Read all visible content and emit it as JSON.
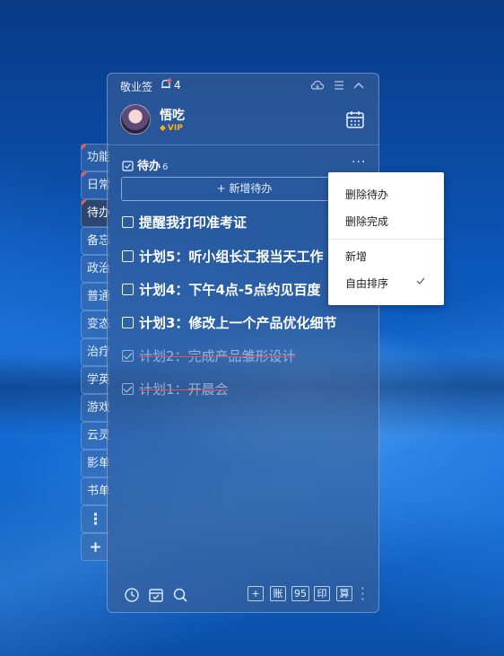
{
  "side_tabs": [
    {
      "label": "功能",
      "flag": true
    },
    {
      "label": "日常",
      "flag": true
    },
    {
      "label": "待办",
      "flag": true,
      "active": true
    },
    {
      "label": "备忘",
      "flag": false
    },
    {
      "label": "政治",
      "flag": false
    },
    {
      "label": "普通",
      "flag": false
    },
    {
      "label": "变态",
      "flag": false
    },
    {
      "label": "治疗",
      "flag": false
    },
    {
      "label": "学英",
      "flag": false
    },
    {
      "label": "游戏",
      "flag": false
    },
    {
      "label": "云灵",
      "flag": false
    },
    {
      "label": "影单",
      "flag": false
    },
    {
      "label": "书单",
      "flag": false
    },
    {
      "label": "⋮",
      "flag": false
    },
    {
      "label": "+",
      "flag": false
    }
  ],
  "titlebar": {
    "app_name": "敬业签",
    "notification_count": "4",
    "icons": [
      "cloud-sync-icon",
      "menu-icon",
      "collapse-icon"
    ]
  },
  "profile": {
    "username": "悟吃",
    "badge": "VIP"
  },
  "section": {
    "title": "待办",
    "count": "6",
    "more": "···"
  },
  "add_button": {
    "label": "+ 新增待办"
  },
  "todos": [
    {
      "text": "提醒我打印准考证",
      "done": false
    },
    {
      "text": "计划5：听小组长汇报当天工作",
      "done": false
    },
    {
      "text": "计划4：下午4点-5点约见百度",
      "done": false
    },
    {
      "text": "计划3：修改上一个产品优化细节",
      "done": false
    },
    {
      "text": "计划2：完成产品雏形设计",
      "done": true
    },
    {
      "text": "计划1：开晨会",
      "done": true
    }
  ],
  "bottom_bar": {
    "left_icons": [
      "clock-icon",
      "archive-icon",
      "search-icon"
    ],
    "right_buttons": [
      "+",
      "账",
      "95",
      "印",
      "算"
    ]
  },
  "context_menu": {
    "items": [
      "删除待办",
      "删除完成",
      "新增",
      "自由排序"
    ],
    "checked_item": "自由排序"
  },
  "colors": {
    "accent_flag": "#ff5a3c",
    "vip_gold": "#ffb020",
    "strike_red": "#e65050"
  }
}
